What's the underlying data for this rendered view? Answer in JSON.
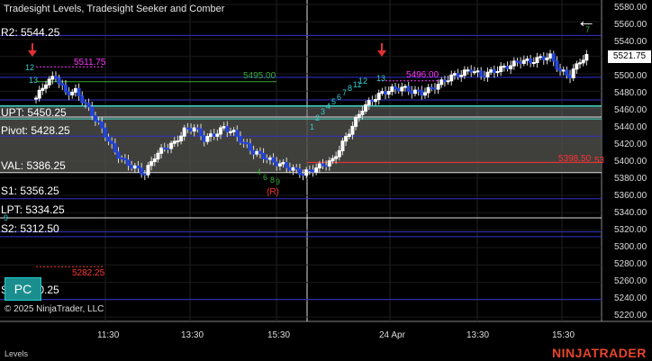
{
  "header": {
    "title": "Tradesight Levels, Tradesight Seeker and Comber"
  },
  "levels": [
    {
      "label": "R2: 5544.25",
      "color": "#3333cc",
      "price": 5544.25
    },
    {
      "label": "UPT: 5450.25",
      "color": "#dddddd",
      "price": 5450.25
    },
    {
      "label": "Pivot: 5428.25",
      "color": "#3333cc",
      "price": 5428.25
    },
    {
      "label": "VAL: 5386.25",
      "color": "#dddddd",
      "price": 5386.25
    },
    {
      "label": "S1: 5356.25",
      "color": "#3333cc",
      "price": 5356.25
    },
    {
      "label": "LPT: 5334.25",
      "color": "#dddddd",
      "price": 5334.25
    },
    {
      "label": "S2: 5312.50",
      "color": "#3333cc",
      "price": 5312.5
    },
    {
      "label": "S3: 5240.25",
      "color": "#3333cc",
      "price": 5240.25
    }
  ],
  "price_axis": [
    "5580.00",
    "5560.00",
    "5540.00",
    "5520.00",
    "5500.00",
    "5480.00",
    "5460.00",
    "5440.00",
    "5420.00",
    "5400.00",
    "5380.00",
    "5360.00",
    "5340.00",
    "5320.00",
    "5300.00",
    "5280.00",
    "5260.00",
    "5240.00",
    "5220.00"
  ],
  "current_price": "5521.75",
  "time_axis": [
    "11:30",
    "13:30",
    "15:30",
    "24 Apr",
    "13:30",
    "15:30"
  ],
  "annotations": [
    {
      "text": "5511.75",
      "color": "#ff33ff"
    },
    {
      "text": "5495.00",
      "color": "#33aa33"
    },
    {
      "text": "5496.00",
      "color": "#ff33ff"
    },
    {
      "text": "5398.50",
      "color": "#ff3333"
    },
    {
      "text": "5282.25",
      "color": "#ff3333"
    },
    {
      "text": "(R)",
      "color": "#ff3333"
    },
    {
      "text": "53",
      "color": "#ff3333"
    }
  ],
  "pattern_numbers": [
    "12",
    "13",
    "13",
    "1",
    "2",
    "3",
    "4",
    "5",
    "6",
    "7",
    "8",
    "9",
    "10",
    "11",
    "12",
    "9",
    "3",
    "4",
    "5",
    "6",
    "7",
    "8",
    "9",
    "7"
  ],
  "copyright": "© 2025 NinjaTrader, LLC",
  "pc_button": "PC",
  "back_icon": "←",
  "footer_label": "Levels",
  "brand": "NINJATRADER",
  "chart_data": {
    "type": "candlestick",
    "x_range": [
      "10:30",
      "15:50 (24 Apr)"
    ],
    "ylim": [
      5215,
      5585
    ],
    "close_path": [
      5472,
      5490,
      5497,
      5478,
      5480,
      5465,
      5448,
      5430,
      5410,
      5398,
      5392,
      5385,
      5405,
      5415,
      5420,
      5435,
      5438,
      5425,
      5430,
      5438,
      5432,
      5420,
      5410,
      5405,
      5398,
      5395,
      5390,
      5385,
      5390,
      5395,
      5400,
      5420,
      5440,
      5460,
      5470,
      5478,
      5482,
      5484,
      5480,
      5478,
      5483,
      5490,
      5497,
      5500,
      5505,
      5498,
      5502,
      5506,
      5510,
      5515,
      5514,
      5518,
      5520,
      5503,
      5498,
      5515,
      5521.75
    ]
  }
}
